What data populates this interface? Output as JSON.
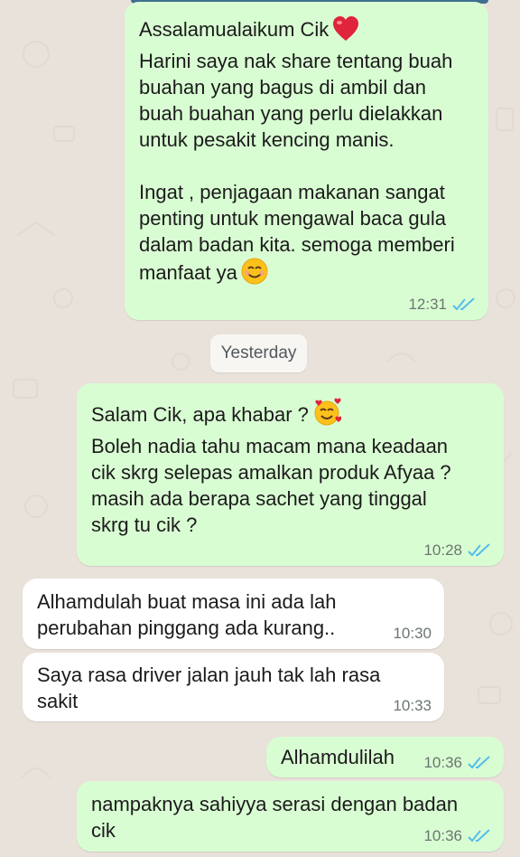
{
  "colors": {
    "outgoing_bubble": "#d9fdd3",
    "incoming_bubble": "#ffffff",
    "read_ticks": "#53bdeb",
    "background": "#e9e2da"
  },
  "date_separator": "Yesterday",
  "messages": [
    {
      "direction": "outgoing",
      "text": "Assalamualaikum Cik",
      "text_after_emoji": "",
      "text_2": "\nHarini saya nak share tentang buah\nbuahan yang bagus di ambil dan\nbuah buahan yang perlu dielakkan\nuntuk pesakit kencing manis.\n\nIngat , penjagaan makanan sangat\npenting untuk mengawal baca gula\ndalam badan kita. semoga memberi\nmanfaat ya",
      "emoji_1": "red-heart",
      "emoji_2": "smiling-face-with-smiling-eyes",
      "time": "12:31",
      "status": "read"
    },
    {
      "direction": "outgoing",
      "text": "Salam Cik, apa khabar ?",
      "text_2": "\nBoleh nadia tahu macam mana keadaan\ncik skrg selepas amalkan produk Afyaa ?\nmasih ada berapa sachet yang tinggal\nskrg tu cik ?",
      "emoji_1": "smiling-face-with-hearts",
      "time": "10:28",
      "status": "read"
    },
    {
      "direction": "incoming",
      "text": "Alhamdulah buat masa ini ada lah\nperubahan pinggang ada kurang..",
      "time": "10:30"
    },
    {
      "direction": "incoming",
      "text": "Saya rasa driver jalan jauh tak lah rasa\nsakit",
      "time": "10:33"
    },
    {
      "direction": "outgoing",
      "text": "Alhamdulilah",
      "time": "10:36",
      "status": "read"
    },
    {
      "direction": "outgoing",
      "text": "nampaknya sahiyya serasi dengan badan\ncik",
      "time": "10:36",
      "status": "read"
    }
  ]
}
